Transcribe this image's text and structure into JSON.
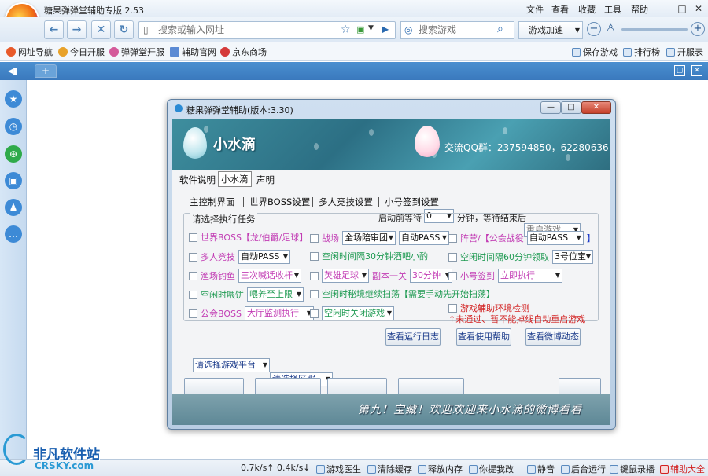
{
  "browser": {
    "title": "糖果弹弹堂辅助专版 2.53",
    "menu": [
      "文件",
      "查看",
      "收藏",
      "工具",
      "帮助"
    ],
    "url_placeholder": "搜索或输入网址",
    "search_placeholder": "搜索游戏",
    "accel_label": "游戏加速",
    "favorites": [
      {
        "label": "网址导航",
        "color": "#e85a2a"
      },
      {
        "label": "今日开服",
        "color": "#e8a22a"
      },
      {
        "label": "弹弹堂开服",
        "color": "#d45a9a"
      },
      {
        "label": "辅助官网",
        "color": "#5a8ad4"
      },
      {
        "label": "京东商场",
        "color": "#d43a3a"
      }
    ],
    "fav_right": [
      "保存游戏",
      "排行榜",
      "开服表"
    ],
    "sidebar_icons": [
      "star-icon",
      "clock-icon",
      "gamepad-icon",
      "toolbox-icon",
      "user-icon",
      "chat-icon"
    ],
    "status": {
      "speed_up": "0.7k/s↑",
      "speed_down": "0.4k/s↓",
      "items": [
        "游戏医生",
        "清除缓存",
        "释放内存",
        "你提我改",
        "静音",
        "后台运行",
        "键鼠录播",
        "辅助大全"
      ]
    },
    "watermark": {
      "title": "非凡软件站",
      "sub": "CRSKY.com"
    }
  },
  "dialog": {
    "title": "糖果弹弹堂辅助(版本:3.30)",
    "banner_name": "小水滴",
    "banner_qq": "交流QQ群：237594850，62280636",
    "tabs": [
      "软件说明",
      "小水滴",
      "声明"
    ],
    "subtabs": [
      "主控制界面",
      "世界BOSS设置",
      "多人竞技设置",
      "小号签到设置"
    ],
    "group_title": "请选择执行任务",
    "start_wait_label": "启动前等待",
    "start_wait_value": "0",
    "minutes_end_label": "分钟，等待结束后",
    "after_action": "重启游戏",
    "tasks": {
      "world_boss": "世界BOSS【龙/伯爵/足球】",
      "battle": "战场",
      "battle_mode": "全场陪审团",
      "battle_pass": "自动PASS",
      "camp": "阵营/【公会战役",
      "camp_pass": "自动PASS",
      "camp_close": "】",
      "multi": "多人竞技",
      "multi_pass": "自动PASS",
      "idle30": "空闲时间隔30分钟酒吧小酌",
      "idle60": "空闲时间隔60分钟领取",
      "idle60_select": "3号位宝",
      "fishing": "渔场钓鱼",
      "fishing_select": "三次喊话收杆",
      "hero": "英雄足球",
      "copy": "副本一关",
      "copy_time": "30分钟",
      "checkin": "小号签到",
      "checkin_select": "立即执行",
      "pet": "空闲时喂饼",
      "pet_select": "喂养至上限",
      "secret": "空闲时秘境继续扫荡【需要手动先开始扫荡】",
      "guild_boss": "公会BOSS",
      "guild_select": "大厅监测执行",
      "close_game": "空闲时关闭游戏",
      "env_check": "游戏辅助环境检测",
      "env_note": "↑未通过、暂不能掉线自动重启游戏"
    },
    "platform_select": "请选择游戏平台",
    "server_select": "请选择区服",
    "buttons": [
      "查看运行日志",
      "查看使用帮助",
      "查看微博动态"
    ],
    "footer_text": "第九！宝藏！欢迎欢迎来小水滴的微博看看"
  }
}
